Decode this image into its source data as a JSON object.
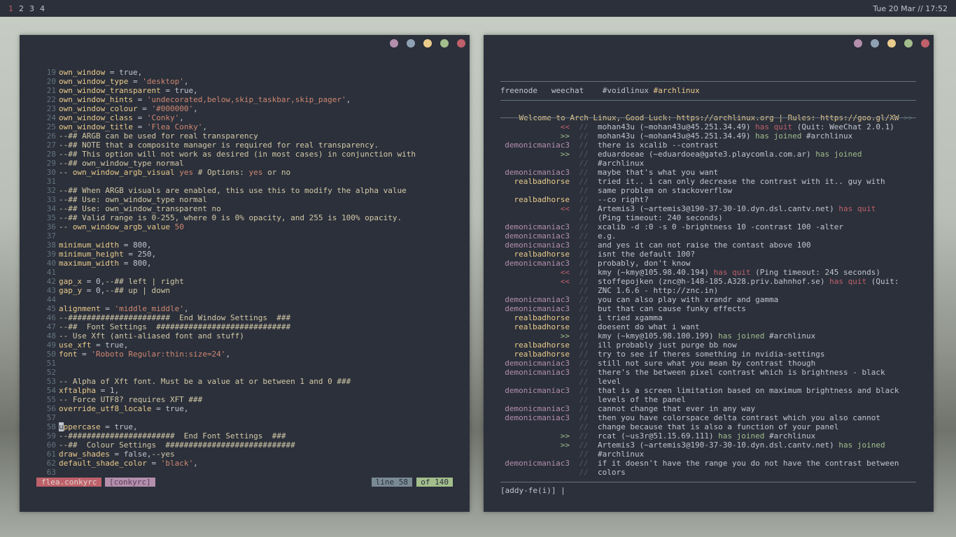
{
  "topbar": {
    "workspaces": [
      "1",
      "2",
      "3",
      "4"
    ],
    "active_workspace": "1",
    "clock": "Tue 20 Mar // 17:52"
  },
  "window_buttons": [
    "#b48ead",
    "#8fa1b3",
    "#ebcb8b",
    "#a3be8c",
    "#bf616a"
  ],
  "editor": {
    "filename": "flea.conkyrc",
    "filetype": "[conkyrc]",
    "line_status": "line 58",
    "of_status": "of 140",
    "lines": [
      {
        "n": "19",
        "t": "own_window = true,"
      },
      {
        "n": "20",
        "t": "own_window_type = 'desktop',"
      },
      {
        "n": "21",
        "t": "own_window_transparent = true,"
      },
      {
        "n": "22",
        "t": "own_window_hints = 'undecorated,below,skip_taskbar,skip_pager',"
      },
      {
        "n": "23",
        "t": "own_window_colour = '#000000',"
      },
      {
        "n": "24",
        "t": "own_window_class = 'Conky',"
      },
      {
        "n": "25",
        "t": "own_window_title = 'Flea Conky',"
      },
      {
        "n": "26",
        "t": "--## ARGB can be used for real transparency"
      },
      {
        "n": "27",
        "t": "--## NOTE that a composite manager is required for real transparency."
      },
      {
        "n": "28",
        "t": "--## This option will not work as desired (in most cases) in conjunction with"
      },
      {
        "n": "29",
        "t": "--## own_window_type normal"
      },
      {
        "n": "30",
        "t": "-- own_window_argb_visual yes # Options: yes or no"
      },
      {
        "n": "31",
        "t": ""
      },
      {
        "n": "32",
        "t": "--## When ARGB visuals are enabled, this use this to modify the alpha value"
      },
      {
        "n": "33",
        "t": "--## Use: own_window_type normal"
      },
      {
        "n": "34",
        "t": "--## Use: own_window_transparent no"
      },
      {
        "n": "35",
        "t": "--## Valid range is 0-255, where 0 is 0% opacity, and 255 is 100% opacity."
      },
      {
        "n": "36",
        "t": "-- own_window_argb_value 50"
      },
      {
        "n": "37",
        "t": ""
      },
      {
        "n": "38",
        "t": "minimum_width = 800,"
      },
      {
        "n": "39",
        "t": "minimum_height = 250,"
      },
      {
        "n": "40",
        "t": "maximum_width = 800,"
      },
      {
        "n": "41",
        "t": ""
      },
      {
        "n": "42",
        "t": "gap_x = 0,--## left | right"
      },
      {
        "n": "43",
        "t": "gap_y = 0,--## up | down"
      },
      {
        "n": "44",
        "t": ""
      },
      {
        "n": "45",
        "t": "alignment = 'middle_middle',"
      },
      {
        "n": "46",
        "t": "--######################  End Window Settings  ###"
      },
      {
        "n": "47",
        "t": "--##  Font Settings  #############################"
      },
      {
        "n": "48",
        "t": "-- Use Xft (anti-aliased font and stuff)"
      },
      {
        "n": "49",
        "t": "use_xft = true,"
      },
      {
        "n": "50",
        "t": "font = 'Roboto Regular:thin:size=24',"
      },
      {
        "n": "51",
        "t": ""
      },
      {
        "n": "52",
        "t": ""
      },
      {
        "n": "53",
        "t": "-- Alpha of Xft font. Must be a value at or between 1 and 0 ###"
      },
      {
        "n": "54",
        "t": "xftalpha = 1,"
      },
      {
        "n": "55",
        "t": "-- Force UTF8? requires XFT ###"
      },
      {
        "n": "56",
        "t": "override_utf8_locale = true,"
      },
      {
        "n": "57",
        "t": ""
      },
      {
        "n": "58",
        "t": "uppercase = true,"
      },
      {
        "n": "59",
        "t": "--#######################  End Font Settings  ###"
      },
      {
        "n": "60",
        "t": "--##  Colour Settings  ############################"
      },
      {
        "n": "61",
        "t": "draw_shades = false,--yes"
      },
      {
        "n": "62",
        "t": "default_shade_color = 'black',"
      },
      {
        "n": "63",
        "t": ""
      }
    ]
  },
  "chat": {
    "buffers": [
      "freenode",
      "weechat",
      "#voidlinux",
      "#archlinux"
    ],
    "topic": "Welcome to Arch Linux, Good Luck: https://archlinux.org | Rules: https://goo.gl/XW",
    "topic_more": ">>",
    "input": "[addy-fe(i)] |",
    "lines": [
      {
        "nick": "<<",
        "k": "q",
        "sep": "//",
        "msg": "mohan43u (~mohan43u@45.251.34.49) ",
        "tag": "has quit",
        "tail": " (Quit: WeeChat 2.0.1)"
      },
      {
        "nick": ">>",
        "k": "j",
        "sep": "//",
        "msg": "mohan43u (~mohan43u@45.251.34.49) ",
        "tag": "has joined",
        "tail": " #archlinux"
      },
      {
        "nick": "demonicmaniac3",
        "k": "dm",
        "sep": "//",
        "msg": "there is xcalib --contrast"
      },
      {
        "nick": ">>",
        "k": "j",
        "sep": "//",
        "msg": "eduardoeae (~eduardoea@gate3.playcomla.com.ar) ",
        "tag": "has joined",
        "tail": ""
      },
      {
        "nick": "",
        "k": "",
        "sep": "//",
        "msg": "#archlinux"
      },
      {
        "nick": "demonicmaniac3",
        "k": "dm",
        "sep": "//",
        "msg": "maybe that's what you want"
      },
      {
        "nick": "realbadhorse",
        "k": "rb",
        "sep": "//",
        "msg": "tried it.. i can only decrease the contrast with it.. guy with"
      },
      {
        "nick": "",
        "k": "",
        "sep": "//",
        "msg": "same problem on stackoverflow"
      },
      {
        "nick": "realbadhorse",
        "k": "rb",
        "sep": "//",
        "msg": "--co right?"
      },
      {
        "nick": "<<",
        "k": "q",
        "sep": "//",
        "msg": "Artemis3 (~artemis3@190-37-30-10.dyn.dsl.cantv.net) ",
        "tag": "has quit",
        "tail": ""
      },
      {
        "nick": "",
        "k": "",
        "sep": "//",
        "msg": "(Ping timeout: 240 seconds)"
      },
      {
        "nick": "demonicmaniac3",
        "k": "dm",
        "sep": "//",
        "msg": "xcalib -d :0 -s 0 -brightness 10 -contrast 100 -alter"
      },
      {
        "nick": "demonicmaniac3",
        "k": "dm",
        "sep": "//",
        "msg": "e.g."
      },
      {
        "nick": "demonicmaniac3",
        "k": "dm",
        "sep": "//",
        "msg": "and yes it can not raise the contast above 100"
      },
      {
        "nick": "realbadhorse",
        "k": "rb",
        "sep": "//",
        "msg": "isnt the default 100?"
      },
      {
        "nick": "demonicmaniac3",
        "k": "dm",
        "sep": "//",
        "msg": "probably, don't know"
      },
      {
        "nick": "<<",
        "k": "q",
        "sep": "//",
        "msg": "kmy (~kmy@105.98.40.194) ",
        "tag": "has quit",
        "tail": " (Ping timeout: 245 seconds)"
      },
      {
        "nick": "<<",
        "k": "q",
        "sep": "//",
        "msg": "stoffepojken (znc@h-148-185.A328.priv.bahnhof.se) ",
        "tag": "has quit",
        "tail": " (Quit:"
      },
      {
        "nick": "",
        "k": "",
        "sep": "//",
        "msg": "ZNC 1.6.6 - http://znc.in)"
      },
      {
        "nick": "demonicmaniac3",
        "k": "dm",
        "sep": "//",
        "msg": "you can also play with xrandr and gamma"
      },
      {
        "nick": "demonicmaniac3",
        "k": "dm",
        "sep": "//",
        "msg": "but that can cause funky effects"
      },
      {
        "nick": "realbadhorse",
        "k": "rb",
        "sep": "//",
        "msg": "i tried xgamma"
      },
      {
        "nick": "realbadhorse",
        "k": "rb",
        "sep": "//",
        "msg": "doesent do what i want"
      },
      {
        "nick": ">>",
        "k": "j",
        "sep": "//",
        "msg": "kmy (~kmy@105.98.100.199) ",
        "tag": "has joined",
        "tail": " #archlinux"
      },
      {
        "nick": "realbadhorse",
        "k": "rb",
        "sep": "//",
        "msg": "ill probably just purge bb now"
      },
      {
        "nick": "realbadhorse",
        "k": "rb",
        "sep": "//",
        "msg": "try to see if theres something in nvidia-settings"
      },
      {
        "nick": "demonicmaniac3",
        "k": "dm",
        "sep": "//",
        "msg": "still not sure what you mean by contrast though"
      },
      {
        "nick": "demonicmaniac3",
        "k": "dm",
        "sep": "//",
        "msg": "there's the between pixel contrast which is brightness - black"
      },
      {
        "nick": "",
        "k": "",
        "sep": "//",
        "msg": "level"
      },
      {
        "nick": "demonicmaniac3",
        "k": "dm",
        "sep": "//",
        "msg": "that is a screen limitation based on maximum brightness and black"
      },
      {
        "nick": "",
        "k": "",
        "sep": "//",
        "msg": "levels of the panel"
      },
      {
        "nick": "demonicmaniac3",
        "k": "dm",
        "sep": "//",
        "msg": "cannot change that ever in any way"
      },
      {
        "nick": "demonicmaniac3",
        "k": "dm",
        "sep": "//",
        "msg": "then you have colorspace delta contrast which you also cannot"
      },
      {
        "nick": "",
        "k": "",
        "sep": "//",
        "msg": "change because that is also a function of your panel"
      },
      {
        "nick": ">>",
        "k": "j",
        "sep": "//",
        "msg": "rcat (~us3r@51.15.69.111) ",
        "tag": "has joined",
        "tail": " #archlinux"
      },
      {
        "nick": ">>",
        "k": "j",
        "sep": "//",
        "msg": "Artemis3 (~artemis3@190-37-30-10.dyn.dsl.cantv.net) ",
        "tag": "has joined",
        "tail": ""
      },
      {
        "nick": "",
        "k": "",
        "sep": "//",
        "msg": "#archlinux"
      },
      {
        "nick": "demonicmaniac3",
        "k": "dm",
        "sep": "//",
        "msg": "if it doesn't have the range you do not have the contrast between"
      },
      {
        "nick": "",
        "k": "",
        "sep": "//",
        "msg": "colors"
      }
    ]
  }
}
